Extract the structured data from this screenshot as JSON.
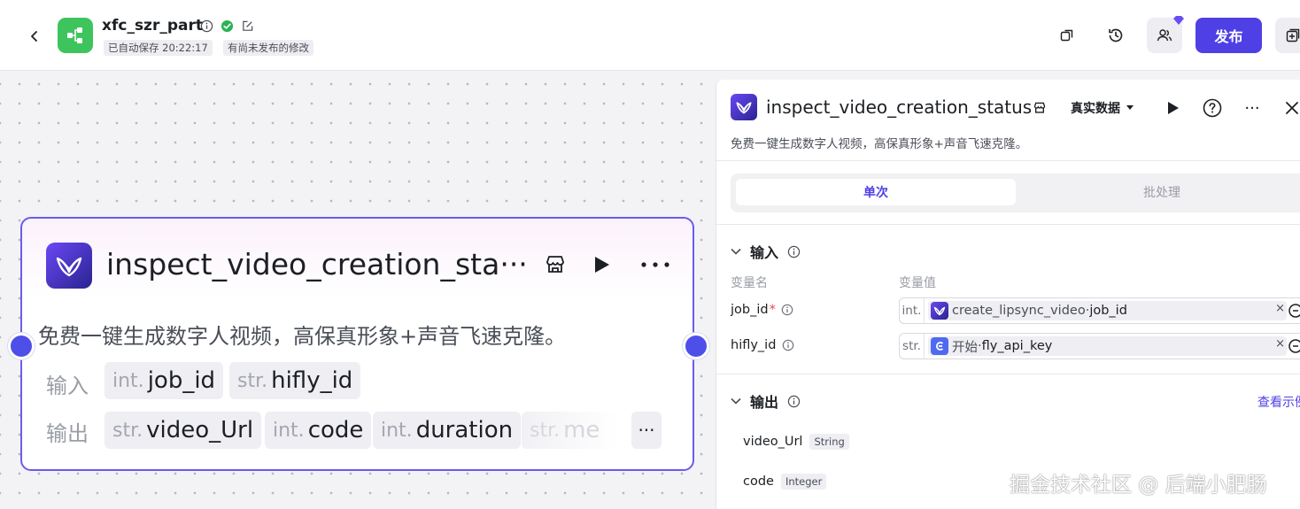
{
  "header": {
    "title": "xfc_szr_part",
    "autosave": "已自动保存 20:22:17",
    "unpublished": "有尚未发布的修改",
    "publish_label": "发布"
  },
  "node": {
    "title": "inspect_video_creation_sta···",
    "description": "免费一键生成数字人视频，高保真形象+声音飞速克隆。",
    "input_label": "输入",
    "output_label": "输出",
    "inputs": [
      {
        "type": "int.",
        "name": "job_id"
      },
      {
        "type": "str.",
        "name": "hifly_id"
      }
    ],
    "outputs": [
      {
        "type": "str.",
        "name": "video_Url"
      },
      {
        "type": "int.",
        "name": "code"
      },
      {
        "type": "int.",
        "name": "duration"
      },
      {
        "type": "str.",
        "name": "me"
      }
    ],
    "more_label": "···"
  },
  "panel": {
    "title": "inspect_video_creation_status",
    "data_mode": "真实数据",
    "more_label": "···",
    "description": "免费一键生成数字人视频，高保真形象+声音飞速克隆。",
    "tabs": [
      "单次",
      "批处理"
    ],
    "input_section": "输入",
    "col_name": "变量名",
    "col_value": "变量值",
    "variables": [
      {
        "name": "job_id",
        "required": "*",
        "type": "int.",
        "ref_source": "create_lipsync_video",
        "ref_sep": " · ",
        "ref_field": "job_id",
        "clear": "×"
      },
      {
        "name": "hifly_id",
        "required": "",
        "type": "str.",
        "ref_source": "开始",
        "ref_sep": " · ",
        "ref_field": "fly_api_key",
        "clear": "×"
      }
    ],
    "output_section": "输出",
    "view_example": "查看示例",
    "outputs": [
      {
        "name": "video_Url",
        "type": "String"
      },
      {
        "name": "code",
        "type": "Integer"
      }
    ]
  },
  "watermark": "掘金技术社区 @ 后端小肥肠",
  "colors": {
    "accent": "#4e40e5",
    "app_icon": "#3ec45c",
    "port": "#4e4fe8",
    "node_border": "#6a5cf0"
  }
}
